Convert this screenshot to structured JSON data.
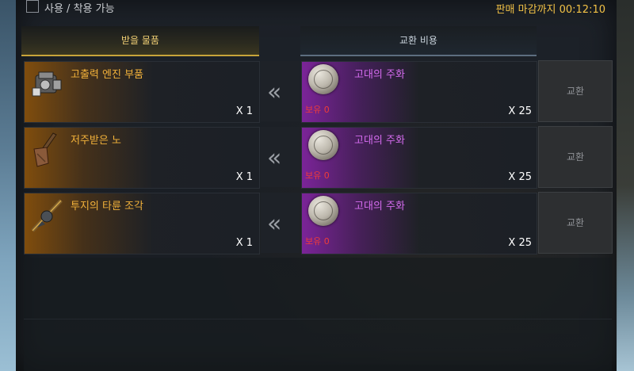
{
  "filter": {
    "usable_label": "사용 / 착용 가능"
  },
  "deadline": {
    "text": "판매 마감까지 00:12:10"
  },
  "tabs": {
    "receive": "받을 물품",
    "cost": "교환 비용"
  },
  "rows": [
    {
      "item": {
        "name": "고출력 엔진 부품",
        "qty": "X 1",
        "icon": "engine-part-icon"
      },
      "cost": {
        "name": "고대의 주화",
        "owned": "보유 0",
        "qty": "X 25",
        "icon": "coin-icon"
      },
      "exchange": "교환"
    },
    {
      "item": {
        "name": "저주받은 노",
        "qty": "X 1",
        "icon": "oar-icon"
      },
      "cost": {
        "name": "고대의 주화",
        "owned": "보유 0",
        "qty": "X 25",
        "icon": "coin-icon"
      },
      "exchange": "교환"
    },
    {
      "item": {
        "name": "투지의 타륜 조각",
        "qty": "X 1",
        "icon": "helm-fragment-icon"
      },
      "cost": {
        "name": "고대의 주화",
        "owned": "보유 0",
        "qty": "X 25",
        "icon": "coin-icon"
      },
      "exchange": "교환"
    }
  ],
  "arrow_glyph": "«",
  "colors": {
    "item_name": "#f3b23a",
    "cost_name": "#d46bee",
    "owned_zero": "#ef3b3b",
    "deadline": "#f3c246"
  }
}
